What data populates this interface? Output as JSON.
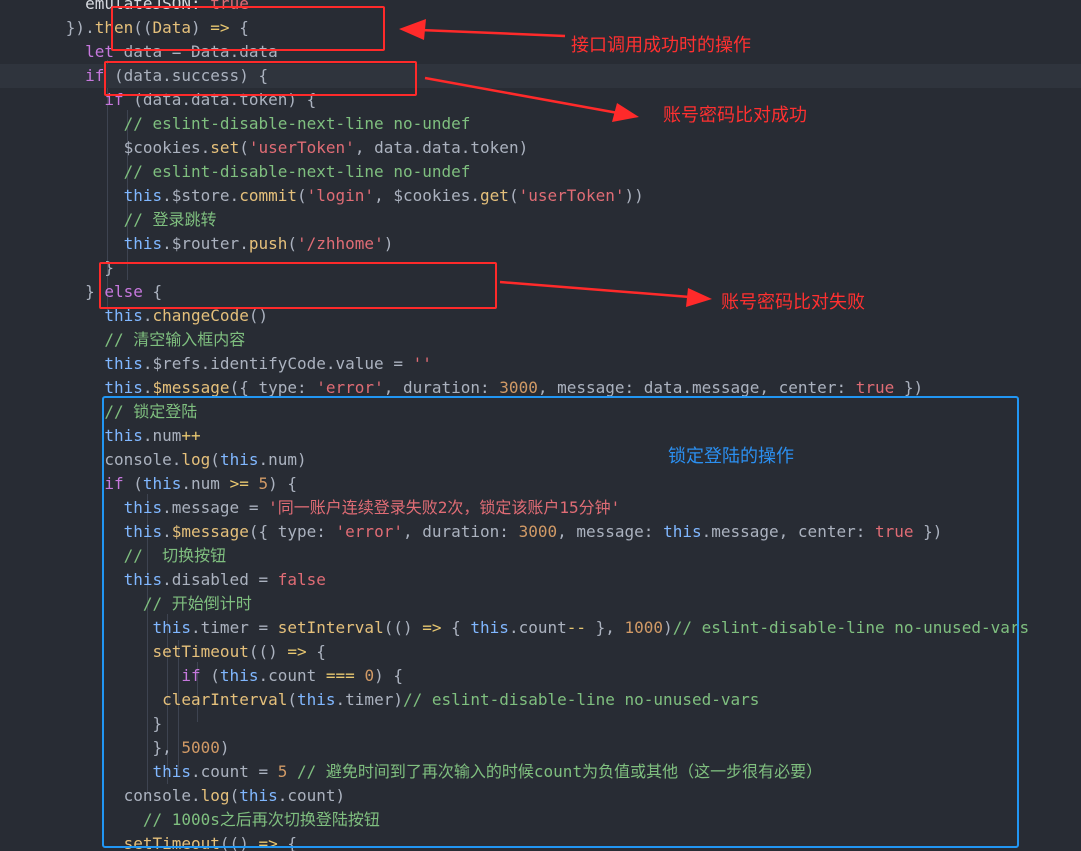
{
  "editor": {
    "lines": [
      [
        {
          "t": "        emulateJSON: ",
          "c": "prop"
        },
        {
          "t": "true",
          "c": "bool"
        }
      ],
      [
        {
          "t": "      }).",
          "c": "punc"
        },
        {
          "t": "then",
          "c": "fn"
        },
        {
          "t": "((",
          "c": "punc"
        },
        {
          "t": "Data",
          "c": "param"
        },
        {
          "t": ") ",
          "c": "punc"
        },
        {
          "t": "=>",
          "c": "op"
        },
        {
          "t": " {",
          "c": "punc"
        }
      ],
      [
        {
          "t": "        ",
          "c": "punc"
        },
        {
          "t": "let",
          "c": "kw"
        },
        {
          "t": " data = Data.data",
          "c": "var"
        }
      ],
      [
        {
          "t": "        ",
          "c": "punc"
        },
        {
          "t": "if",
          "c": "kw"
        },
        {
          "t": " (data.success) {",
          "c": "var"
        }
      ],
      [
        {
          "t": "          ",
          "c": "punc"
        },
        {
          "t": "if",
          "c": "kw"
        },
        {
          "t": " (data.data.token) {",
          "c": "var"
        }
      ],
      [
        {
          "t": "            // eslint-disable-next-line no-undef",
          "c": "com"
        }
      ],
      [
        {
          "t": "            $cookies.",
          "c": "var"
        },
        {
          "t": "set",
          "c": "fn"
        },
        {
          "t": "(",
          "c": "punc"
        },
        {
          "t": "'userToken'",
          "c": "str"
        },
        {
          "t": ", data.data.token)",
          "c": "var"
        }
      ],
      [
        {
          "t": "            // eslint-disable-next-line no-undef",
          "c": "com"
        }
      ],
      [
        {
          "t": "            ",
          "c": "punc"
        },
        {
          "t": "this",
          "c": "this"
        },
        {
          "t": ".$store.",
          "c": "var"
        },
        {
          "t": "commit",
          "c": "fn"
        },
        {
          "t": "(",
          "c": "punc"
        },
        {
          "t": "'login'",
          "c": "str"
        },
        {
          "t": ", $cookies.",
          "c": "var"
        },
        {
          "t": "get",
          "c": "fn"
        },
        {
          "t": "(",
          "c": "punc"
        },
        {
          "t": "'userToken'",
          "c": "str"
        },
        {
          "t": "))",
          "c": "punc"
        }
      ],
      [
        {
          "t": "            // 登录跳转",
          "c": "com"
        }
      ],
      [
        {
          "t": "            ",
          "c": "punc"
        },
        {
          "t": "this",
          "c": "this"
        },
        {
          "t": ".$router.",
          "c": "var"
        },
        {
          "t": "push",
          "c": "fn"
        },
        {
          "t": "(",
          "c": "punc"
        },
        {
          "t": "'/zhhome'",
          "c": "str"
        },
        {
          "t": ")",
          "c": "punc"
        }
      ],
      [
        {
          "t": "          }",
          "c": "punc"
        }
      ],
      [
        {
          "t": "        } ",
          "c": "punc"
        },
        {
          "t": "else",
          "c": "kw"
        },
        {
          "t": " {",
          "c": "punc"
        }
      ],
      [
        {
          "t": "          ",
          "c": "punc"
        },
        {
          "t": "this",
          "c": "this"
        },
        {
          "t": ".",
          "c": "var"
        },
        {
          "t": "changeCode",
          "c": "fn"
        },
        {
          "t": "()",
          "c": "punc"
        }
      ],
      [
        {
          "t": "          // 清空输入框内容",
          "c": "com"
        }
      ],
      [
        {
          "t": "          ",
          "c": "punc"
        },
        {
          "t": "this",
          "c": "this"
        },
        {
          "t": ".$refs.identifyCode.value = ",
          "c": "var"
        },
        {
          "t": "''",
          "c": "str"
        }
      ],
      [
        {
          "t": "          ",
          "c": "punc"
        },
        {
          "t": "this",
          "c": "this"
        },
        {
          "t": ".",
          "c": "var"
        },
        {
          "t": "$message",
          "c": "fn"
        },
        {
          "t": "({ type: ",
          "c": "var"
        },
        {
          "t": "'error'",
          "c": "str"
        },
        {
          "t": ", duration: ",
          "c": "var"
        },
        {
          "t": "3000",
          "c": "num"
        },
        {
          "t": ", message: data.message, center: ",
          "c": "var"
        },
        {
          "t": "true",
          "c": "bool"
        },
        {
          "t": " })",
          "c": "punc"
        }
      ],
      [
        {
          "t": "          // 锁定登陆",
          "c": "com"
        }
      ],
      [
        {
          "t": "          ",
          "c": "punc"
        },
        {
          "t": "this",
          "c": "this"
        },
        {
          "t": ".num",
          "c": "var"
        },
        {
          "t": "++",
          "c": "op"
        }
      ],
      [
        {
          "t": "          console.",
          "c": "var"
        },
        {
          "t": "log",
          "c": "fn"
        },
        {
          "t": "(",
          "c": "punc"
        },
        {
          "t": "this",
          "c": "this"
        },
        {
          "t": ".num)",
          "c": "var"
        }
      ],
      [
        {
          "t": "          ",
          "c": "punc"
        },
        {
          "t": "if",
          "c": "kw"
        },
        {
          "t": " (",
          "c": "punc"
        },
        {
          "t": "this",
          "c": "this"
        },
        {
          "t": ".num ",
          "c": "var"
        },
        {
          "t": ">=",
          "c": "op"
        },
        {
          "t": " ",
          "c": "punc"
        },
        {
          "t": "5",
          "c": "num"
        },
        {
          "t": ") {",
          "c": "punc"
        }
      ],
      [
        {
          "t": "            ",
          "c": "punc"
        },
        {
          "t": "this",
          "c": "this"
        },
        {
          "t": ".message = ",
          "c": "var"
        },
        {
          "t": "'同一账户连续登录失败2次，锁定该账户15分钟'",
          "c": "str"
        }
      ],
      [
        {
          "t": "            ",
          "c": "punc"
        },
        {
          "t": "this",
          "c": "this"
        },
        {
          "t": ".",
          "c": "var"
        },
        {
          "t": "$message",
          "c": "fn"
        },
        {
          "t": "({ type: ",
          "c": "var"
        },
        {
          "t": "'error'",
          "c": "str"
        },
        {
          "t": ", duration: ",
          "c": "var"
        },
        {
          "t": "3000",
          "c": "num"
        },
        {
          "t": ", message: ",
          "c": "var"
        },
        {
          "t": "this",
          "c": "this"
        },
        {
          "t": ".message, center: ",
          "c": "var"
        },
        {
          "t": "true",
          "c": "bool"
        },
        {
          "t": " })",
          "c": "punc"
        }
      ],
      [
        {
          "t": "            //  切换按钮",
          "c": "com"
        }
      ],
      [
        {
          "t": "            ",
          "c": "punc"
        },
        {
          "t": "this",
          "c": "this"
        },
        {
          "t": ".disabled = ",
          "c": "var"
        },
        {
          "t": "false",
          "c": "bool"
        }
      ],
      [
        {
          "t": "              // 开始倒计时",
          "c": "com"
        }
      ],
      [
        {
          "t": "               ",
          "c": "punc"
        },
        {
          "t": "this",
          "c": "this"
        },
        {
          "t": ".timer = ",
          "c": "var"
        },
        {
          "t": "setInterval",
          "c": "fn"
        },
        {
          "t": "(() ",
          "c": "punc"
        },
        {
          "t": "=>",
          "c": "op"
        },
        {
          "t": " { ",
          "c": "punc"
        },
        {
          "t": "this",
          "c": "this"
        },
        {
          "t": ".count",
          "c": "var"
        },
        {
          "t": "--",
          "c": "op"
        },
        {
          "t": " }, ",
          "c": "punc"
        },
        {
          "t": "1000",
          "c": "num"
        },
        {
          "t": ")",
          "c": "punc"
        },
        {
          "t": "// eslint-disable-line no-unused-vars",
          "c": "com"
        }
      ],
      [
        {
          "t": "               ",
          "c": "punc"
        },
        {
          "t": "setTimeout",
          "c": "fn"
        },
        {
          "t": "(() ",
          "c": "punc"
        },
        {
          "t": "=>",
          "c": "op"
        },
        {
          "t": " {",
          "c": "punc"
        }
      ],
      [
        {
          "t": "                  ",
          "c": "punc"
        },
        {
          "t": "if",
          "c": "kw"
        },
        {
          "t": " (",
          "c": "punc"
        },
        {
          "t": "this",
          "c": "this"
        },
        {
          "t": ".count ",
          "c": "var"
        },
        {
          "t": "===",
          "c": "op"
        },
        {
          "t": " ",
          "c": "punc"
        },
        {
          "t": "0",
          "c": "num"
        },
        {
          "t": ") {",
          "c": "punc"
        }
      ],
      [
        {
          "t": "                ",
          "c": "punc"
        },
        {
          "t": "clearInterval",
          "c": "fn"
        },
        {
          "t": "(",
          "c": "punc"
        },
        {
          "t": "this",
          "c": "this"
        },
        {
          "t": ".timer)",
          "c": "var"
        },
        {
          "t": "// eslint-disable-line no-unused-vars",
          "c": "com"
        }
      ],
      [
        {
          "t": "               }",
          "c": "punc"
        }
      ],
      [
        {
          "t": "               }, ",
          "c": "punc"
        },
        {
          "t": "5000",
          "c": "num"
        },
        {
          "t": ")",
          "c": "punc"
        }
      ],
      [
        {
          "t": "               ",
          "c": "punc"
        },
        {
          "t": "this",
          "c": "this"
        },
        {
          "t": ".count = ",
          "c": "var"
        },
        {
          "t": "5",
          "c": "num"
        },
        {
          "t": " // 避免时间到了再次输入的时候count为负值或其他（这一步很有必要）",
          "c": "com"
        }
      ],
      [
        {
          "t": "            console.",
          "c": "var"
        },
        {
          "t": "log",
          "c": "fn"
        },
        {
          "t": "(",
          "c": "punc"
        },
        {
          "t": "this",
          "c": "this"
        },
        {
          "t": ".count)",
          "c": "var"
        }
      ],
      [
        {
          "t": "              // 1000s之后再次切换登陆按钮",
          "c": "com"
        }
      ],
      [
        {
          "t": "            ",
          "c": "punc"
        },
        {
          "t": "setTimeout",
          "c": "fn"
        },
        {
          "t": "(() ",
          "c": "punc"
        },
        {
          "t": "=>",
          "c": "op"
        },
        {
          "t": " {",
          "c": "punc"
        }
      ]
    ]
  },
  "annotations": {
    "then_note": "接口调用成功时的操作",
    "success_note": "账号密码比对成功",
    "fail_note": "账号密码比对失败",
    "lock_note": "锁定登陆的操作"
  },
  "colors": {
    "annotation_red": "#ff2a2a",
    "annotation_blue": "#2196f3",
    "editor_bg": "#282c34"
  }
}
